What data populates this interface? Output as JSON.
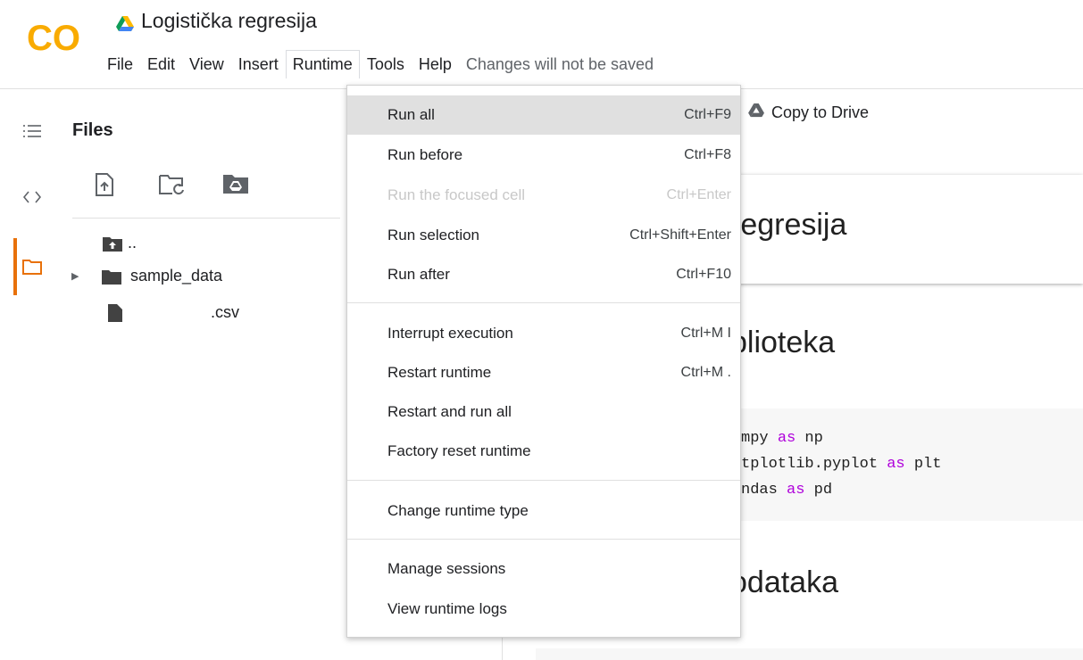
{
  "app": {
    "logo_text": "CO",
    "title": "Logistička regresija",
    "brand_colors": {
      "logo": "#f9ab00",
      "active_rail": "#e8710a",
      "keyword": "#af00db"
    }
  },
  "menubar": {
    "items": [
      "File",
      "Edit",
      "View",
      "Insert",
      "Runtime",
      "Tools",
      "Help"
    ],
    "active": "Runtime",
    "status": "Changes will not be saved"
  },
  "sidebar": {
    "icons": [
      "table-of-contents-icon",
      "code-snippets-icon",
      "files-icon"
    ],
    "active": "files-icon"
  },
  "files": {
    "title": "Files",
    "tools": [
      "upload-icon",
      "refresh-folder-icon",
      "mount-drive-icon"
    ],
    "tree": [
      {
        "icon": "folder-up-icon",
        "label": ".."
      },
      {
        "icon": "folder-icon",
        "label": "sample_data",
        "expandable": true
      },
      {
        "icon": "file-icon",
        "label": ".csv"
      }
    ]
  },
  "toolbar": {
    "copy_to_drive": "Copy to Drive"
  },
  "notebook": {
    "heading1": "regresija",
    "heading2": "blioteka",
    "code_lines": [
      [
        "mpy ",
        "as",
        " np"
      ],
      [
        "tplotlib.pyplot ",
        "as",
        " plt"
      ],
      [
        "ndas ",
        "as",
        " pd"
      ]
    ],
    "heading3": "odataka"
  },
  "runtime_menu": {
    "groups": [
      [
        {
          "label": "Run all",
          "shortcut": "Ctrl+F9",
          "state": "hover"
        },
        {
          "label": "Run before",
          "shortcut": "Ctrl+F8"
        },
        {
          "label": "Run the focused cell",
          "shortcut": "Ctrl+Enter",
          "state": "disabled"
        },
        {
          "label": "Run selection",
          "shortcut": "Ctrl+Shift+Enter"
        },
        {
          "label": "Run after",
          "shortcut": "Ctrl+F10"
        }
      ],
      [
        {
          "label": "Interrupt execution",
          "shortcut": "Ctrl+M I"
        },
        {
          "label": "Restart runtime",
          "shortcut": "Ctrl+M ."
        },
        {
          "label": "Restart and run all",
          "shortcut": ""
        },
        {
          "label": "Factory reset runtime",
          "shortcut": ""
        }
      ],
      [
        {
          "label": "Change runtime type",
          "shortcut": ""
        }
      ],
      [
        {
          "label": "Manage sessions",
          "shortcut": ""
        },
        {
          "label": "View runtime logs",
          "shortcut": ""
        }
      ]
    ]
  }
}
